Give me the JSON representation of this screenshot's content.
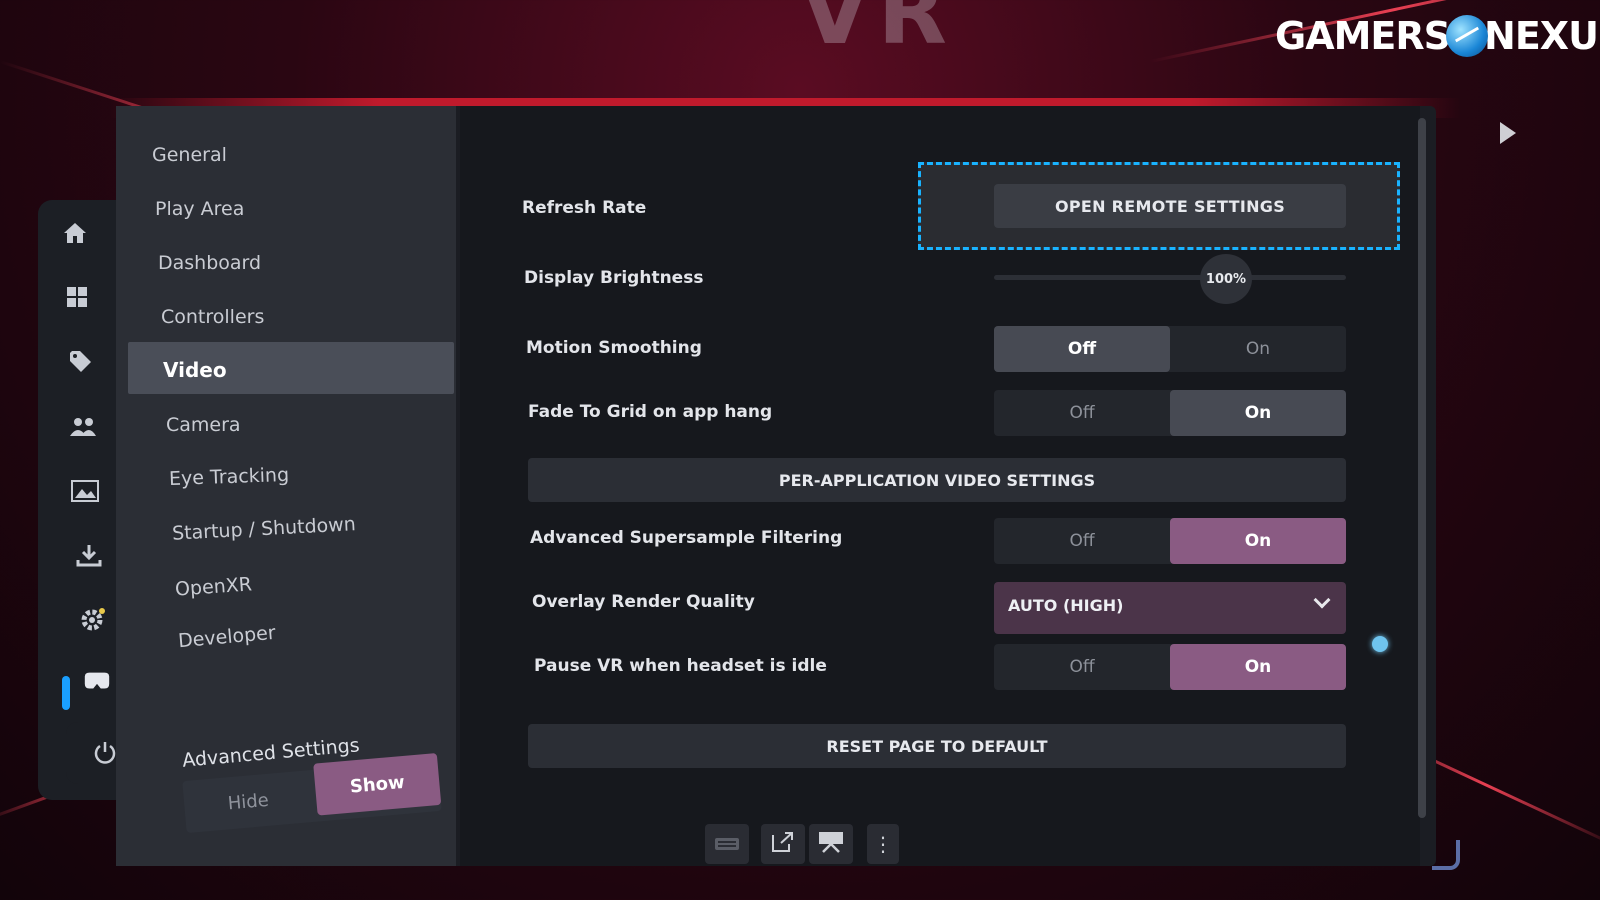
{
  "background": {
    "title_text": "VR"
  },
  "logo": {
    "left": "GAMERS",
    "right": "NEXUS"
  },
  "rail": {
    "icons": [
      "home-icon",
      "grid-icon",
      "tag-icon",
      "friends-icon",
      "media-icon",
      "download-icon",
      "settings-icon",
      "headset-icon",
      "power-icon"
    ]
  },
  "sidebar": {
    "items": [
      {
        "label": "General"
      },
      {
        "label": "Play Area"
      },
      {
        "label": "Dashboard"
      },
      {
        "label": "Controllers"
      },
      {
        "label": "Video"
      },
      {
        "label": "Camera"
      },
      {
        "label": "Eye Tracking"
      },
      {
        "label": "Startup / Shutdown"
      },
      {
        "label": "OpenXR"
      },
      {
        "label": "Developer"
      }
    ],
    "active": "Video",
    "advanced": {
      "label": "Advanced Settings",
      "hide": "Hide",
      "show": "Show",
      "selected": "Show"
    }
  },
  "content": {
    "refresh_rate": {
      "label": "Refresh Rate",
      "button": "OPEN REMOTE SETTINGS"
    },
    "display_brightness": {
      "label": "Display Brightness",
      "value": "100%"
    },
    "motion_smoothing": {
      "label": "Motion Smoothing",
      "off": "Off",
      "on": "On",
      "selected": "Off"
    },
    "fade_to_grid": {
      "label": "Fade To Grid on app hang",
      "off": "Off",
      "on": "On",
      "selected": "On"
    },
    "per_app_button": "PER-APPLICATION VIDEO SETTINGS",
    "supersample": {
      "label": "Advanced Supersample Filtering",
      "off": "Off",
      "on": "On",
      "selected": "On"
    },
    "overlay_quality": {
      "label": "Overlay Render Quality",
      "value": "AUTO (HIGH)"
    },
    "pause_vr": {
      "label": "Pause VR when headset is idle",
      "off": "Off",
      "on": "On",
      "selected": "On"
    },
    "reset_button": "RESET PAGE TO DEFAULT"
  },
  "toolbar": {
    "icons": [
      "keyboard-icon",
      "external-window-icon",
      "desktop-icon",
      "more-icon"
    ],
    "more_glyph": "⋮"
  },
  "colors": {
    "accent": "#1a9fff",
    "selected_purple": "#8a5b83",
    "panel": "#1b1d23"
  }
}
